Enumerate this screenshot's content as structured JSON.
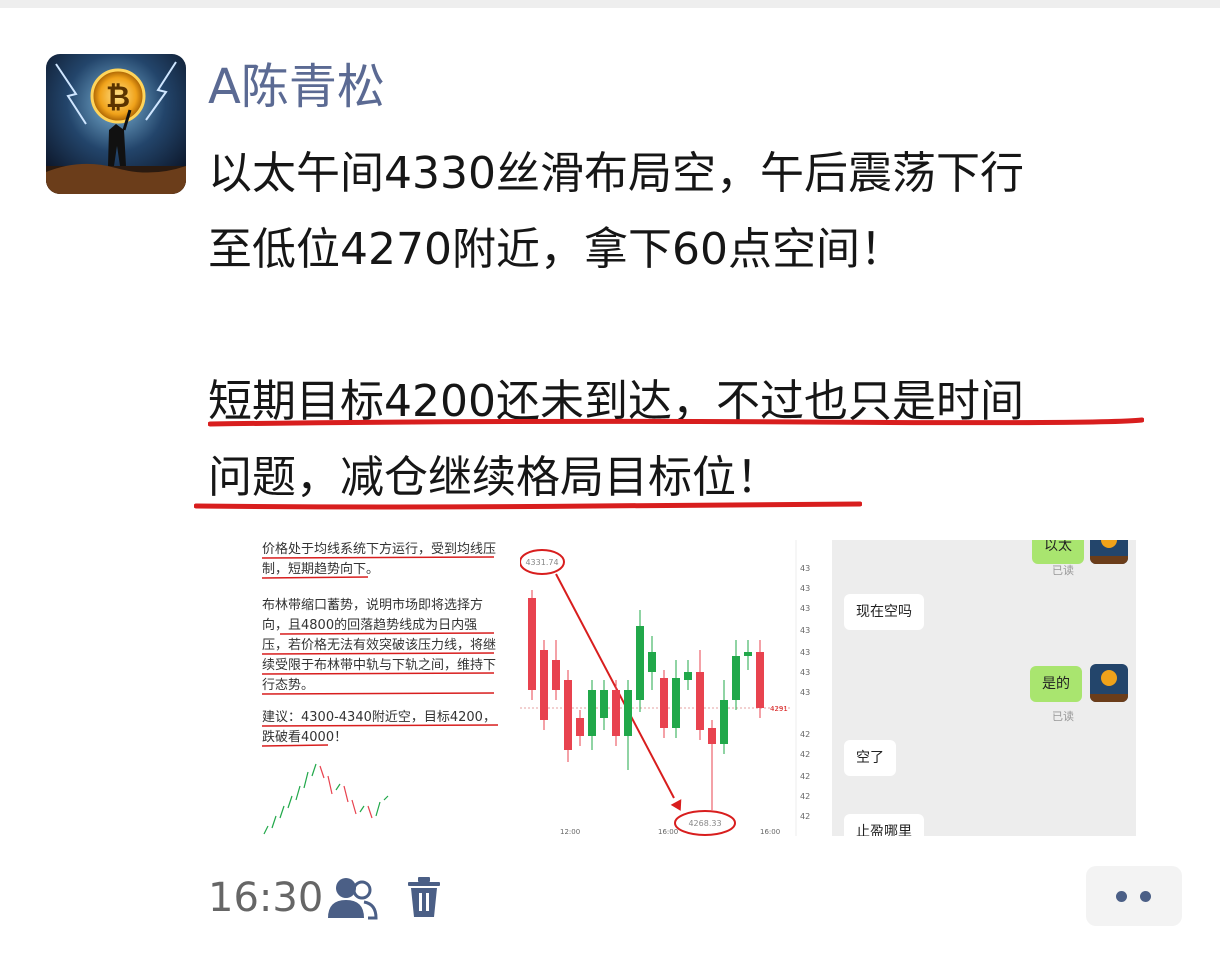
{
  "author": {
    "name": "A陈青松"
  },
  "post": {
    "lines": [
      "以太午间4330丝滑布局空，午后震荡下行",
      "至低位4270附近，拿下60点空间！",
      "短期目标4200还未到达，不过也只是时间",
      "问题，减仓继续格局目标位！"
    ]
  },
  "image": {
    "text_panel": {
      "p1": "价格处于均线系统下方运行，受到均线压制，短期趋势向下。",
      "p2": "布林带缩口蓄势，说明市场即将选择方向，且4800的回落趋势线成为日内强压，若价格无法有效突破该压力线，将继续受限于布林带中轨与下轨之间，维持下行态势。",
      "p3": "建议：4300-4340附近空，目标4200，跌破看4000！"
    },
    "chart_panel": {
      "high_label": "4331.74",
      "low_label": "4268.33",
      "price_tag": "4291",
      "time_labels": [
        "12:00",
        "16:00",
        "16:00"
      ],
      "axis_labels": [
        "43",
        "43",
        "43",
        "43",
        "43",
        "43",
        "43",
        "42",
        "42",
        "42",
        "42",
        "42",
        "42"
      ]
    },
    "chat_panel": {
      "msgs": [
        {
          "text": "以太",
          "side": "me"
        },
        {
          "text": "已读",
          "side": "read"
        },
        {
          "text": "现在空吗",
          "side": "other"
        },
        {
          "text": "是的",
          "side": "me"
        },
        {
          "text": "已读",
          "side": "read"
        },
        {
          "text": "空了",
          "side": "other"
        },
        {
          "text": "止盈哪里",
          "side": "other"
        }
      ]
    }
  },
  "footer": {
    "time": "16:30"
  },
  "colors": {
    "author": "#5b6a93",
    "underline": "#d81e1e",
    "bull": "#21a84a",
    "bear": "#e8434f",
    "icon": "#4b5f86"
  }
}
